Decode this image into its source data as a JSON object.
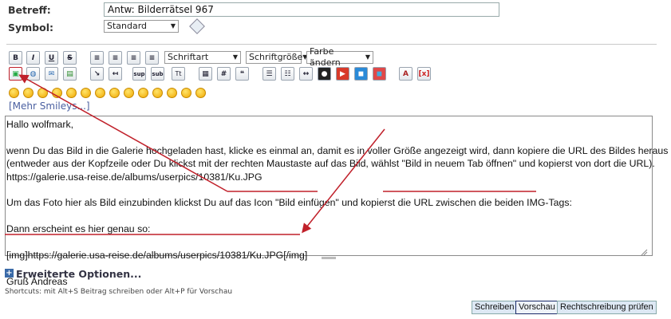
{
  "form": {
    "subject_label": "Betreff:",
    "subject_value": "Antw: Bilderrätsel 967",
    "symbol_label": "Symbol:",
    "symbol_value": "Standard"
  },
  "toolbar": {
    "font_select": "Schriftart",
    "size_select": "Schriftgröße",
    "color_select": "Farbe ändern",
    "bold": "B",
    "italic": "I",
    "underline": "U",
    "strike": "S",
    "sup": "sup",
    "sub": "sub",
    "tt": "Tt",
    "hash": "#"
  },
  "smileys": {
    "more_link": "[Mehr Smileys...]"
  },
  "editor": {
    "lines": [
      "Hallo wolfmark,",
      "",
      "wenn Du das Bild in die Galerie hochgeladen hast, klicke es einmal an, damit es in voller Größe angezeigt wird, dann kopiere die URL des Bildes heraus",
      "(entweder aus der Kopfzeile oder Du klickst mit der rechten Maustaste auf das Bild, wählst \"Bild in neuem Tab öffnen\" und kopierst von dort die URL).",
      "https://galerie.usa-reise.de/albums/userpics/10381/Ku.JPG",
      "",
      "Um das Foto hier als Bild einzubinden klickst Du auf das Icon \"Bild einfügen\" und kopierst die URL zwischen die beiden IMG-Tags:",
      "",
      "Dann erscheint es hier genau so:",
      "",
      "[img]https://galerie.usa-reise.de/albums/userpics/10381/Ku.JPG[/img]",
      "",
      "Gruß Andreas"
    ]
  },
  "advanced": {
    "label": "Erweiterte Optionen..."
  },
  "shortcuts": "Shortcuts: mit Alt+S Beitrag schreiben oder Alt+P für Vorschau",
  "buttons": {
    "write": "Schreiben",
    "preview": "Vorschau",
    "spellcheck": "Rechtschreibung prüfen"
  },
  "colors": {
    "annotation": "#c0202a",
    "link": "#4a5fa0",
    "button_bg": "#dde8f4"
  }
}
